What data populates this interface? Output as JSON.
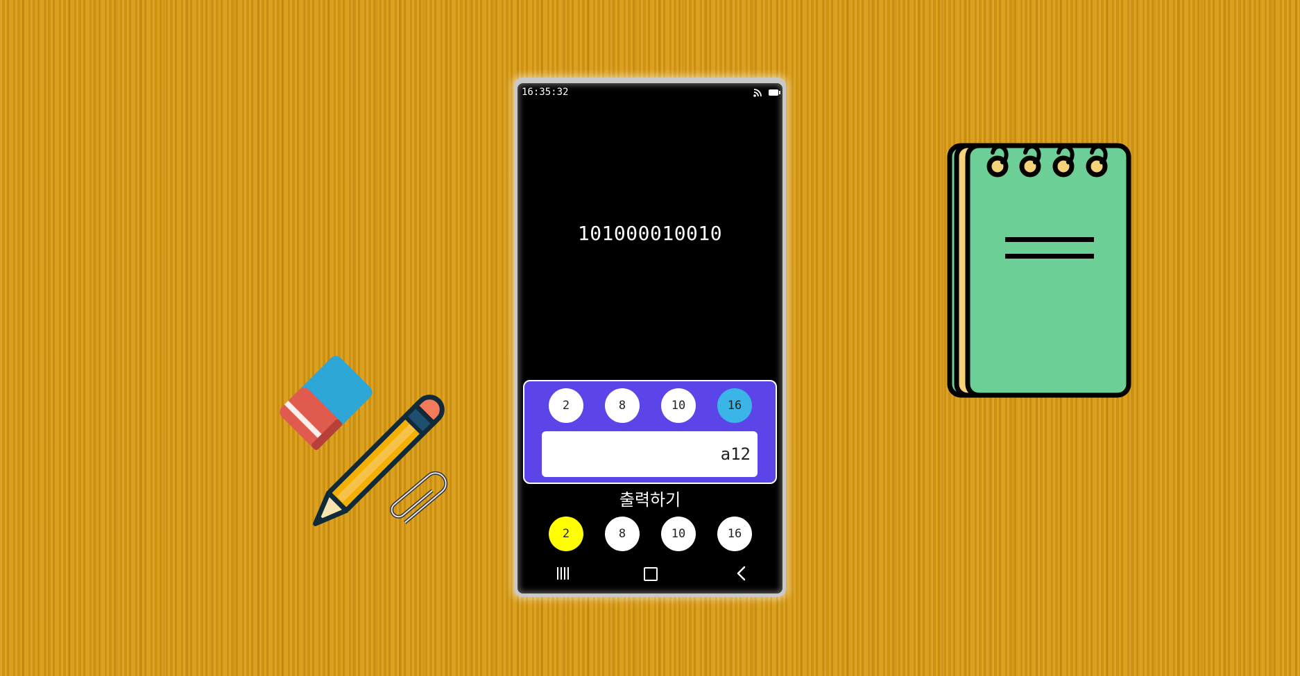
{
  "status_bar": {
    "time": "16:35:32",
    "icons": [
      "cast-icon",
      "battery-icon"
    ]
  },
  "display": {
    "result": "101000010010"
  },
  "input_panel": {
    "bases": [
      "2",
      "8",
      "10",
      "16"
    ],
    "selected_base": "16",
    "value": "a12"
  },
  "output": {
    "label": "출력하기",
    "bases": [
      "2",
      "8",
      "10",
      "16"
    ],
    "selected_base": "2"
  },
  "nav_bar": {
    "icons": [
      "recent-apps-icon",
      "home-icon",
      "back-icon"
    ]
  },
  "colors": {
    "background": "#d99a12",
    "panel": "#5b44e8",
    "input_selected": "#3bb4e8",
    "output_selected": "#ffff00"
  },
  "decorations": [
    "eraser-icon",
    "pencil-icon",
    "paperclip-icon",
    "notepad-icon"
  ]
}
